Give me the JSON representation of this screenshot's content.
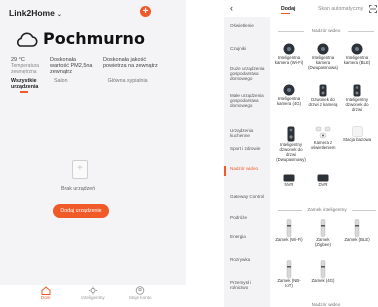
{
  "left": {
    "home_name": "Link2Home",
    "home_chevron": "⌄",
    "add_label": "+",
    "weather_icon": "cloud-icon",
    "weather": "Pochmurno",
    "stats": [
      {
        "value": "29 °C",
        "label": "Temperatura zewnętrzna"
      },
      {
        "value": "Doskonała wartość PM2,5na zewnątrz",
        "label": ""
      },
      {
        "value": "Doskonała jakość powietrza na zewnątrz",
        "label": ""
      }
    ],
    "rooms": [
      "Wszystkie urządzenia",
      "Salon",
      "Główna sypialnia"
    ],
    "empty_text": "Brak urządzeń",
    "add_device": "Dodaj urządzenie",
    "tabs": [
      "Dom",
      "Inteligentny",
      "Moje konto"
    ],
    "accent": "#f05a28"
  },
  "right": {
    "back": "‹",
    "tabs": [
      "Dodaj",
      "Skan automatyczny"
    ],
    "sidebar": [
      "Oświetlenie",
      "Czujniki",
      "Duże urządzenia gospodarstwa domowego",
      "Małe urządzenia gospodarstwa domowego",
      "Urządzenia kuchenne",
      "Sport i zdrowie",
      "Nadzór wideo",
      "Gateway Control",
      "Podróże",
      "Energia",
      "Rozrywka",
      "Przemysł i rolnictwo"
    ],
    "section_video": "Nadzór wideo",
    "section_lock": "Zamek inteligentny",
    "section_more": "Nadzór wideo",
    "devices_video": [
      "Inteligentna kamera (Wi-Fi)",
      "Inteligentna kamera (Dwupasmowa)",
      "Inteligentna kamera (BLE)",
      "Inteligentna kamera (4G)",
      "Dzwonek do drzwi z kamerą",
      "Inteligentny dzwonek do drzwi",
      "Inteligentny dzwonek do drzwi (Dwupasmowy)",
      "Kamera z oświetleniem",
      "Stacja bazowa",
      "NVR",
      "DVR"
    ],
    "devices_lock": [
      "Zamek (Wi-Fi)",
      "Zamek (Zigbee)",
      "Zamek (BLE)",
      "Zamek (NB-IoT)",
      "Zamek (4G)"
    ]
  }
}
